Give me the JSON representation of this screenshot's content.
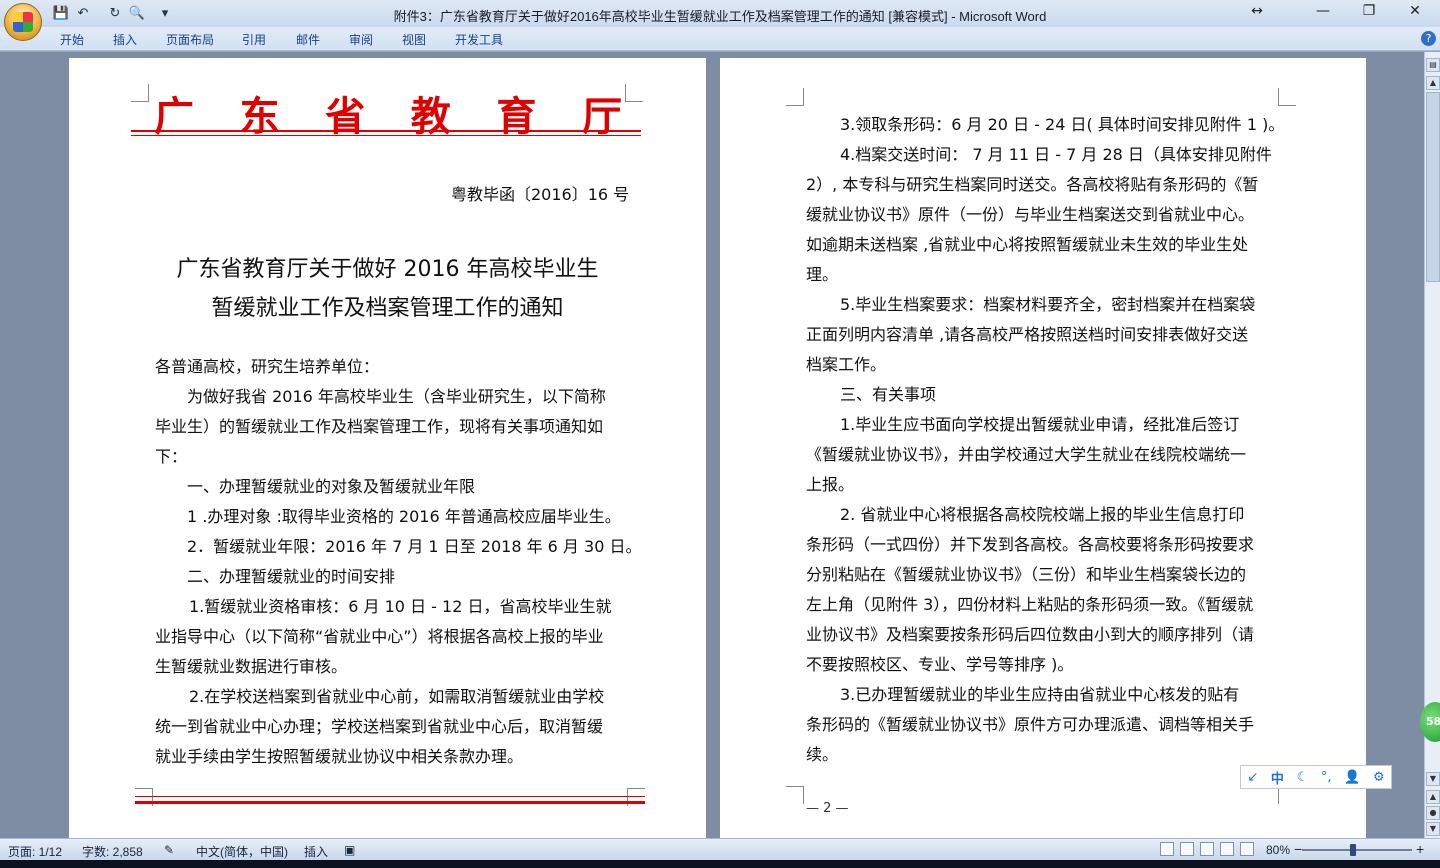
{
  "window": {
    "title": "附件3：广东省教育厅关于做好2016年高校毕业生暂缓就业工作及档案管理工作的通知 [兼容模式] - Microsoft Word",
    "restore_glyph": "↔"
  },
  "quick_access": [
    {
      "name": "save-icon",
      "glyph": "💾"
    },
    {
      "name": "undo-icon",
      "glyph": "↶"
    },
    {
      "name": "redo-icon",
      "glyph": "↻"
    },
    {
      "name": "print-preview-icon",
      "glyph": "🔍"
    },
    {
      "name": "qat-customize-icon",
      "glyph": "▾"
    }
  ],
  "ribbon_tabs": [
    "开始",
    "插入",
    "页面布局",
    "引用",
    "邮件",
    "审阅",
    "视图",
    "开发工具"
  ],
  "page1": {
    "agency_chars": [
      "广",
      "东",
      "省",
      "教",
      "育",
      "厅"
    ],
    "doc_number": "粤教毕函〔2016〕16 号",
    "title_line1": "广东省教育厅关于做好 2016 年高校毕业生",
    "title_line2": "暂缓就业工作及档案管理工作的通知",
    "lines": [
      "各普通高校，研究生培养单位：",
      "为做好我省 2016 年高校毕业生（含毕业研究生，以下简称",
      "毕业生）的暂缓就业工作及档案管理工作，现将有关事项通知如",
      "下：",
      "一、办理暂缓就业的对象及暂缓就业年限",
      "1 .办理对象 :取得毕业资格的 2016 年普通高校应届毕业生。",
      "2．暂缓就业年限：2016 年 7 月 1 日至 2018 年 6 月 30 日。",
      "二、办理暂缓就业的时间安排",
      "1.暂缓就业资格审核：6 月 10 日 - 12 日，省高校毕业生就",
      "业指导中心（以下简称“省就业中心”）将根据各高校上报的毕业",
      "生暂缓就业数据进行审核。",
      "2.在学校送档案到省就业中心前，如需取消暂缓就业由学校",
      "统一到省就业中心办理；学校送档案到省就业中心后，取消暂缓",
      "就业手续由学生按照暂缓就业协议中相关条款办理。"
    ]
  },
  "page2": {
    "lines": [
      "3.领取条形码：6 月 20 日 - 24 日( 具体时间安排见附件 1 )。",
      "4.档案交送时间： 7 月 11 日 - 7 月 28 日（具体安排见附件",
      "2）, 本专科与研究生档案同时送交。各高校将贴有条形码的《暂",
      "缓就业协议书》原件（一份）与毕业生档案送交到省就业中心。",
      "如逾期未送档案 ,省就业中心将按照暂缓就业未生效的毕业生处",
      "理。",
      "5.毕业生档案要求：档案材料要齐全，密封档案并在档案袋",
      "正面列明内容清单 ,请各高校严格按照送档时间安排表做好交送",
      "档案工作。",
      "三、有关事项",
      "1.毕业生应书面向学校提出暂缓就业申请，经批准后签订",
      "《暂缓就业协议书》，并由学校通过大学生就业在线院校端统一",
      "上报。",
      "2. 省就业中心将根据各高校院校端上报的毕业生信息打印",
      "条形码（一式四份）并下发到各高校。各高校要将条形码按要求",
      "分别粘贴在《暂缓就业协议书》（三份）和毕业生档案袋长边的",
      "左上角（见附件 3），四份材料上粘贴的条形码须一致。《暂缓就",
      "业协议书》及档案要按条形码后四位数由小到大的顺序排列（请",
      "不要按照校区、专业、学号等排序 )。",
      "3.已办理暂缓就业的毕业生应持由省就业中心核发的贴有",
      "条形码的《暂缓就业协议书》原件方可办理派遣、调档等相关手",
      "续。"
    ],
    "page_number": "— 2 —"
  },
  "side": {
    "badge": "58"
  },
  "ime": [
    "↙",
    "中",
    "☾",
    "°,",
    "👤",
    "⚙"
  ],
  "status": {
    "page": "页面: 1/12",
    "words": "字数: 2,858",
    "language": "中文(简体，中国)",
    "mode": "插入",
    "zoom": "80%"
  },
  "colors": {
    "red_header": "#e00000"
  }
}
